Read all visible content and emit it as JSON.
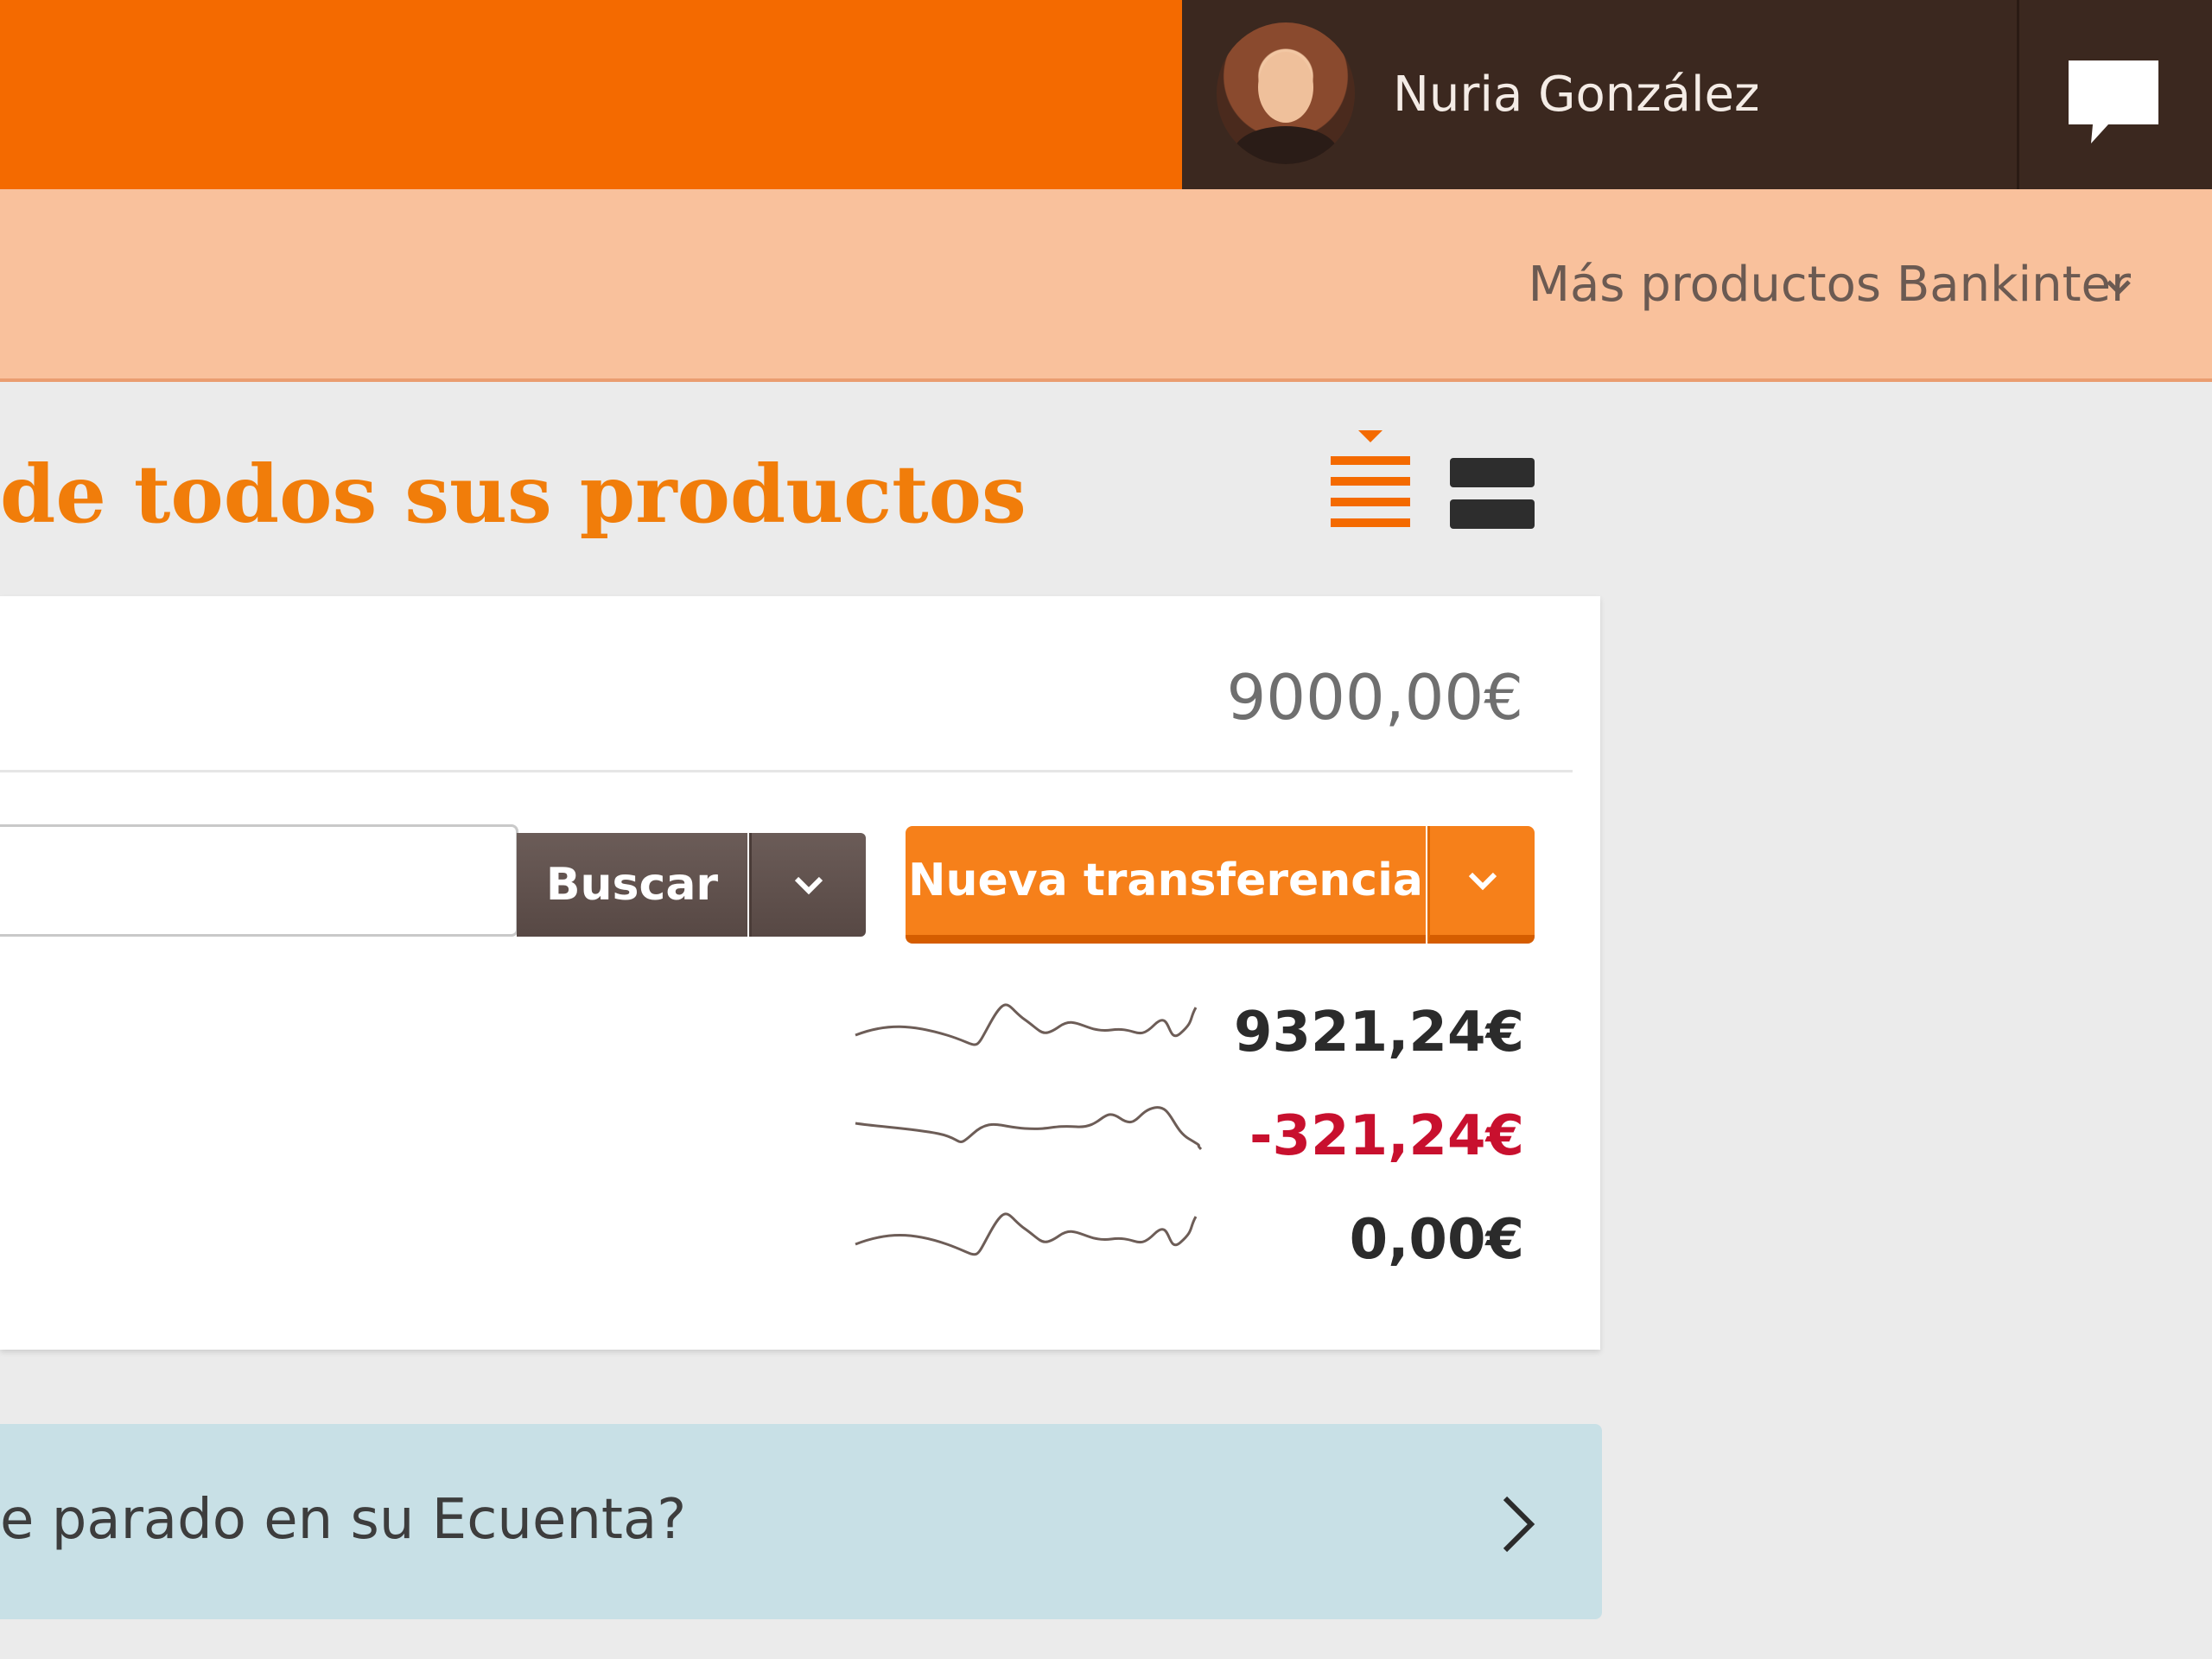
{
  "header": {
    "user_name": "Nuria González",
    "more_products_label": "Más productos Bankinter"
  },
  "main": {
    "title": "de todos sus productos",
    "total_balance": "9000,00€",
    "search": {
      "placeholder": "",
      "button_label": "Buscar"
    },
    "new_transfer_label": "Nueva transferencia",
    "accounts": [
      {
        "amount": "9321,24€",
        "color": "#2b2b2b"
      },
      {
        "amount": "-321,24€",
        "color": "#c8102e"
      },
      {
        "amount": "0,00€",
        "color": "#2b2b2b"
      }
    ]
  },
  "promo": {
    "text": "e parado en su Ecuenta?"
  },
  "icons": {
    "chat": "chat-icon",
    "chevron": "chevron-down-icon",
    "view_list": "list-view-icon",
    "view_block": "block-view-icon",
    "promo_arrow": "chevron-right-icon"
  },
  "colors": {
    "brand_orange": "#f46a00",
    "user_bar": "#3b281f",
    "subbar": "#f9c19c",
    "title_orange": "#f17d0a",
    "negative": "#c8102e",
    "promo_bg": "#c8e0e6"
  }
}
